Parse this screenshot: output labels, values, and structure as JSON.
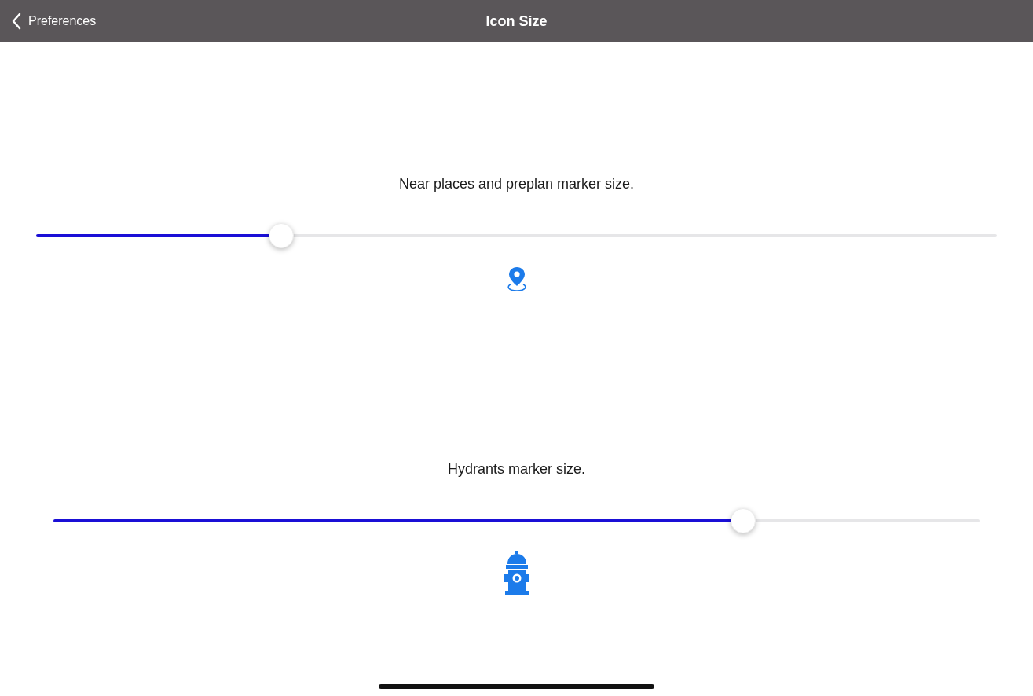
{
  "nav_bar": {
    "back_label": "Preferences",
    "title": "Icon Size"
  },
  "settings": [
    {
      "label": "Near places and preplan marker size.",
      "level": 0.255,
      "kind": "pin"
    },
    {
      "label": "Hydrants marker size.",
      "level": 0.745,
      "kind": "hydrant"
    }
  ]
}
